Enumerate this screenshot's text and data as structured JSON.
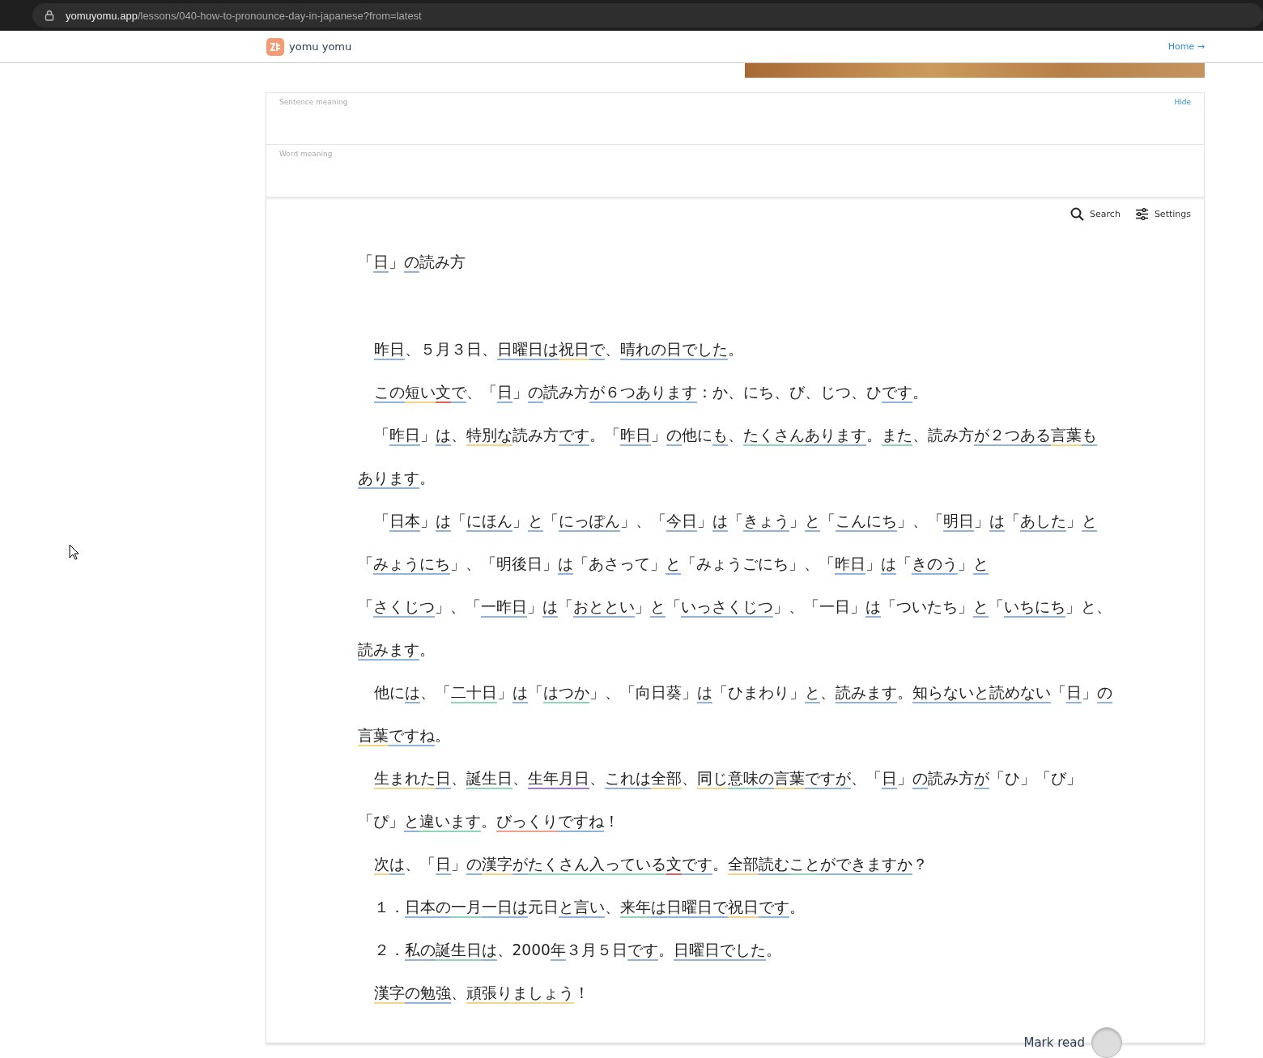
{
  "browser": {
    "url_host": "yomuyomu.app",
    "url_path": "/lessons/040-how-to-pronounce-day-in-japanese?from=latest"
  },
  "header": {
    "brand": "yomu yomu",
    "home_link": "Home →"
  },
  "meaning_panel": {
    "sentence_label": "Sentence meaning",
    "hide_link": "Hide",
    "word_label": "Word meaning"
  },
  "toolbar": {
    "search": "Search",
    "settings": "Settings"
  },
  "title": [
    {
      "text": "「"
    },
    {
      "text": "日",
      "color": "#8fb3dd"
    },
    {
      "text": "」"
    },
    {
      "text": "の",
      "color": "#8fb3dd"
    },
    {
      "text": "読み方"
    }
  ],
  "paragraphs": [
    [
      {
        "text": "昨日",
        "color": "#8fb3dd"
      },
      {
        "text": "、５月３日、"
      },
      {
        "text": "日曜日",
        "color": "#8fb3dd"
      },
      {
        "text": "は",
        "color": "#8fb3dd"
      },
      {
        "text": "祝日",
        "color": "#f5d48a"
      },
      {
        "text": "で",
        "color": "#8fb3dd"
      },
      {
        "text": "、"
      },
      {
        "text": "晴れ",
        "color": "#8fb3dd"
      },
      {
        "text": "の",
        "color": "#8fb3dd"
      },
      {
        "text": "日",
        "color": "#8fb3dd"
      },
      {
        "text": "でした",
        "color": "#8fb3dd"
      },
      {
        "text": "。"
      }
    ],
    [
      {
        "text": "この",
        "color": "#8fb3dd"
      },
      {
        "text": "短い",
        "color": "#f5d48a"
      },
      {
        "text": "文",
        "color": "#e06060"
      },
      {
        "text": "で",
        "color": "#8fb3dd"
      },
      {
        "text": "、「"
      },
      {
        "text": "日",
        "color": "#8fb3dd"
      },
      {
        "text": "」"
      },
      {
        "text": "の",
        "color": "#8fb3dd"
      },
      {
        "text": "読み方"
      },
      {
        "text": "が",
        "color": "#8fb3dd"
      },
      {
        "text": "６つ",
        "color": "#8fb3dd"
      },
      {
        "text": "あります",
        "color": "#8fb3dd"
      },
      {
        "text": "：か、にち、び、じつ、ひ"
      },
      {
        "text": "です",
        "color": "#8fb3dd"
      },
      {
        "text": "。"
      }
    ],
    [
      {
        "text": "「"
      },
      {
        "text": "昨日",
        "color": "#8fb3dd"
      },
      {
        "text": "」"
      },
      {
        "text": "は",
        "color": "#8fb3dd"
      },
      {
        "text": "、"
      },
      {
        "text": "特別な",
        "color": "#f5d48a"
      },
      {
        "text": "読み方"
      },
      {
        "text": "です",
        "color": "#8fb3dd"
      },
      {
        "text": "。「"
      },
      {
        "text": "昨日",
        "color": "#8fb3dd"
      },
      {
        "text": "」"
      },
      {
        "text": "の",
        "color": "#8fb3dd"
      },
      {
        "text": "他に"
      },
      {
        "text": "も",
        "color": "#8fb3dd"
      },
      {
        "text": "、"
      },
      {
        "text": "たくさん",
        "color": "#8fd6b8"
      },
      {
        "text": "あります",
        "color": "#8fb3dd"
      },
      {
        "text": "。"
      },
      {
        "text": "また",
        "color": "#8fd6b8"
      },
      {
        "text": "、読み方"
      },
      {
        "text": "が",
        "color": "#8fb3dd"
      },
      {
        "text": "２つ",
        "color": "#8fb3dd"
      },
      {
        "text": "ある",
        "color": "#8fb3dd"
      },
      {
        "text": "言葉",
        "color": "#f5d48a"
      },
      {
        "text": "も",
        "color": "#8fb3dd"
      },
      {
        "text": "あります",
        "color": "#8fb3dd"
      },
      {
        "text": "。"
      }
    ],
    [
      {
        "text": "「"
      },
      {
        "text": "日本",
        "color": "#8fb3dd"
      },
      {
        "text": "」"
      },
      {
        "text": "は",
        "color": "#8fb3dd"
      },
      {
        "text": "「"
      },
      {
        "text": "にほん",
        "color": "#8fb3dd"
      },
      {
        "text": "」"
      },
      {
        "text": "と",
        "color": "#8fb3dd"
      },
      {
        "text": "「"
      },
      {
        "text": "にっぽん",
        "color": "#8fb3dd"
      },
      {
        "text": "」、「"
      },
      {
        "text": "今日",
        "color": "#8fb3dd"
      },
      {
        "text": "」"
      },
      {
        "text": "は",
        "color": "#8fb3dd"
      },
      {
        "text": "「"
      },
      {
        "text": "きょう",
        "color": "#8fb3dd"
      },
      {
        "text": "」"
      },
      {
        "text": "と",
        "color": "#8fb3dd"
      },
      {
        "text": "「"
      },
      {
        "text": "こんにち",
        "color": "#8fb3dd"
      },
      {
        "text": "」、「"
      },
      {
        "text": "明日",
        "color": "#8fb3dd"
      },
      {
        "text": "」"
      },
      {
        "text": "は",
        "color": "#8fb3dd"
      },
      {
        "text": "「"
      },
      {
        "text": "あした",
        "color": "#8fb3dd"
      },
      {
        "text": "」"
      },
      {
        "text": "と",
        "color": "#8fb3dd"
      },
      {
        "text": "「"
      },
      {
        "text": "みょうにち",
        "color": "#8fb3dd"
      },
      {
        "text": "」、「明後日」"
      },
      {
        "text": "は",
        "color": "#8fb3dd"
      },
      {
        "text": "「あさって」"
      },
      {
        "text": "と",
        "color": "#8fb3dd"
      },
      {
        "text": "「みょうごにち」、「"
      },
      {
        "text": "昨日",
        "color": "#8fb3dd"
      },
      {
        "text": "」"
      },
      {
        "text": "は",
        "color": "#8fb3dd"
      },
      {
        "text": "「"
      },
      {
        "text": "きのう",
        "color": "#8fb3dd"
      },
      {
        "text": "」"
      },
      {
        "text": "と",
        "color": "#8fb3dd"
      },
      {
        "text": "「"
      },
      {
        "text": "さくじつ",
        "color": "#8fb3dd"
      },
      {
        "text": "」"
      },
      {
        "text": "、「"
      },
      {
        "text": "一昨日",
        "color": "#8fb3dd"
      },
      {
        "text": "」"
      },
      {
        "text": "は",
        "color": "#8fb3dd"
      },
      {
        "text": "「"
      },
      {
        "text": "おととい",
        "color": "#8fb3dd"
      },
      {
        "text": "」"
      },
      {
        "text": "と",
        "color": "#8fb3dd"
      },
      {
        "text": "「"
      },
      {
        "text": "いっさくじつ",
        "color": "#8fb3dd"
      },
      {
        "text": "」、「一日」"
      },
      {
        "text": "は",
        "color": "#8fb3dd"
      },
      {
        "text": "「ついたち」"
      },
      {
        "text": "と",
        "color": "#8fb3dd"
      },
      {
        "text": "「"
      },
      {
        "text": "いちにち",
        "color": "#8fb3dd"
      },
      {
        "text": "」と、"
      },
      {
        "text": "読みます",
        "color": "#8fb3dd"
      },
      {
        "text": "。"
      }
    ],
    [
      {
        "text": "他に"
      },
      {
        "text": "は",
        "color": "#8fb3dd"
      },
      {
        "text": "、「"
      },
      {
        "text": "二十日",
        "color": "#8fd6b8"
      },
      {
        "text": "」"
      },
      {
        "text": "は",
        "color": "#8fb3dd"
      },
      {
        "text": "「"
      },
      {
        "text": "はつか",
        "color": "#8fd6b8"
      },
      {
        "text": "」、「向日葵」"
      },
      {
        "text": "は",
        "color": "#8fb3dd"
      },
      {
        "text": "「ひまわり」"
      },
      {
        "text": "と",
        "color": "#8fb3dd"
      },
      {
        "text": "、"
      },
      {
        "text": "読みます",
        "color": "#8fb3dd"
      },
      {
        "text": "。"
      },
      {
        "text": "知らない",
        "color": "#8fb3dd"
      },
      {
        "text": "と",
        "color": "#8fb3dd"
      },
      {
        "text": "読めない",
        "color": "#8fb3dd"
      },
      {
        "text": "「"
      },
      {
        "text": "日",
        "color": "#8fb3dd"
      },
      {
        "text": "」"
      },
      {
        "text": "の",
        "color": "#8fb3dd"
      },
      {
        "text": "言葉",
        "color": "#f5d48a"
      },
      {
        "text": "です",
        "color": "#8fb3dd"
      },
      {
        "text": "ね",
        "color": "#8fb3dd"
      },
      {
        "text": "。"
      }
    ],
    [
      {
        "text": "生まれた",
        "color": "#f5d48a"
      },
      {
        "text": "日",
        "color": "#8fb3dd"
      },
      {
        "text": "、"
      },
      {
        "text": "誕生日",
        "color": "#8fd6b8"
      },
      {
        "text": "、"
      },
      {
        "text": "生年月日",
        "color": "#9b7be0"
      },
      {
        "text": "、"
      },
      {
        "text": "これ",
        "color": "#8fb3dd"
      },
      {
        "text": "は",
        "color": "#8fb3dd"
      },
      {
        "text": "全部",
        "color": "#f5d48a"
      },
      {
        "text": "、"
      },
      {
        "text": "同じ",
        "color": "#f5d48a"
      },
      {
        "text": "意味",
        "color": "#8fd6b8"
      },
      {
        "text": "の",
        "color": "#8fb3dd"
      },
      {
        "text": "言葉",
        "color": "#f5d48a"
      },
      {
        "text": "です",
        "color": "#8fb3dd"
      },
      {
        "text": "が",
        "color": "#8fb3dd"
      },
      {
        "text": "、「"
      },
      {
        "text": "日",
        "color": "#8fb3dd"
      },
      {
        "text": "」"
      },
      {
        "text": "の",
        "color": "#8fb3dd"
      },
      {
        "text": "読み方"
      },
      {
        "text": "が",
        "color": "#8fb3dd"
      },
      {
        "text": "「ひ」「び」"
      },
      {
        "text": "「ぴ」"
      },
      {
        "text": "と",
        "color": "#8fb3dd"
      },
      {
        "text": "違います",
        "color": "#8fd6b8"
      },
      {
        "text": "。"
      },
      {
        "text": "びっくり",
        "color": "#f0a090"
      },
      {
        "text": "です",
        "color": "#8fb3dd"
      },
      {
        "text": "ね",
        "color": "#8fb3dd"
      },
      {
        "text": "！"
      }
    ],
    [
      {
        "text": "次",
        "color": "#f5d48a"
      },
      {
        "text": "は",
        "color": "#8fb3dd"
      },
      {
        "text": "、「"
      },
      {
        "text": "日",
        "color": "#8fb3dd"
      },
      {
        "text": "」"
      },
      {
        "text": "の",
        "color": "#8fb3dd"
      },
      {
        "text": "漢字",
        "color": "#f5d48a"
      },
      {
        "text": "が",
        "color": "#8fb3dd"
      },
      {
        "text": "たくさん",
        "color": "#8fd6b8"
      },
      {
        "text": "入っている",
        "color": "#8fd6b8"
      },
      {
        "text": "文",
        "color": "#e06060"
      },
      {
        "text": "です",
        "color": "#8fb3dd"
      },
      {
        "text": "。"
      },
      {
        "text": "全部",
        "color": "#f5d48a"
      },
      {
        "text": "読む",
        "color": "#8fb3dd"
      },
      {
        "text": "こと",
        "color": "#8fd6b8"
      },
      {
        "text": "が",
        "color": "#8fb3dd"
      },
      {
        "text": "できます",
        "color": "#8fb3dd"
      },
      {
        "text": "か",
        "color": "#8fb3dd"
      },
      {
        "text": "？"
      }
    ],
    [
      {
        "text": "１．"
      },
      {
        "text": "日本",
        "color": "#8fb3dd"
      },
      {
        "text": "の",
        "color": "#8fb3dd"
      },
      {
        "text": "一月",
        "color": "#8fd6b8"
      },
      {
        "text": "一日",
        "color": "#8fb3dd"
      },
      {
        "text": "は",
        "color": "#8fb3dd"
      },
      {
        "text": "元日"
      },
      {
        "text": "と",
        "color": "#8fb3dd"
      },
      {
        "text": "言い",
        "color": "#8fb3dd"
      },
      {
        "text": "、"
      },
      {
        "text": "来年",
        "color": "#8fd6b8"
      },
      {
        "text": "は",
        "color": "#8fb3dd"
      },
      {
        "text": "日曜日",
        "color": "#8fb3dd"
      },
      {
        "text": "で",
        "color": "#8fb3dd"
      },
      {
        "text": "祝日",
        "color": "#f5d48a"
      },
      {
        "text": "です",
        "color": "#8fb3dd"
      },
      {
        "text": "。"
      }
    ],
    [
      {
        "text": "２．"
      },
      {
        "text": "私",
        "color": "#8fb3dd"
      },
      {
        "text": "の",
        "color": "#8fb3dd"
      },
      {
        "text": "誕生日",
        "color": "#8fd6b8"
      },
      {
        "text": "は",
        "color": "#8fb3dd"
      },
      {
        "text": "、2000"
      },
      {
        "text": "年",
        "color": "#8fb3dd"
      },
      {
        "text": "３月５日"
      },
      {
        "text": "です",
        "color": "#8fb3dd"
      },
      {
        "text": "。"
      },
      {
        "text": "日曜日",
        "color": "#8fb3dd"
      },
      {
        "text": "でした",
        "color": "#8fb3dd"
      },
      {
        "text": "。"
      }
    ],
    [
      {
        "text": "漢字",
        "color": "#f5d48a"
      },
      {
        "text": "の",
        "color": "#8fb3dd"
      },
      {
        "text": "勉強",
        "color": "#8fb3dd"
      },
      {
        "text": "、"
      },
      {
        "text": "頑張りましょう",
        "color": "#f5d48a"
      },
      {
        "text": "！"
      }
    ]
  ],
  "mark_read": {
    "label": "Mark read",
    "checked": false
  }
}
